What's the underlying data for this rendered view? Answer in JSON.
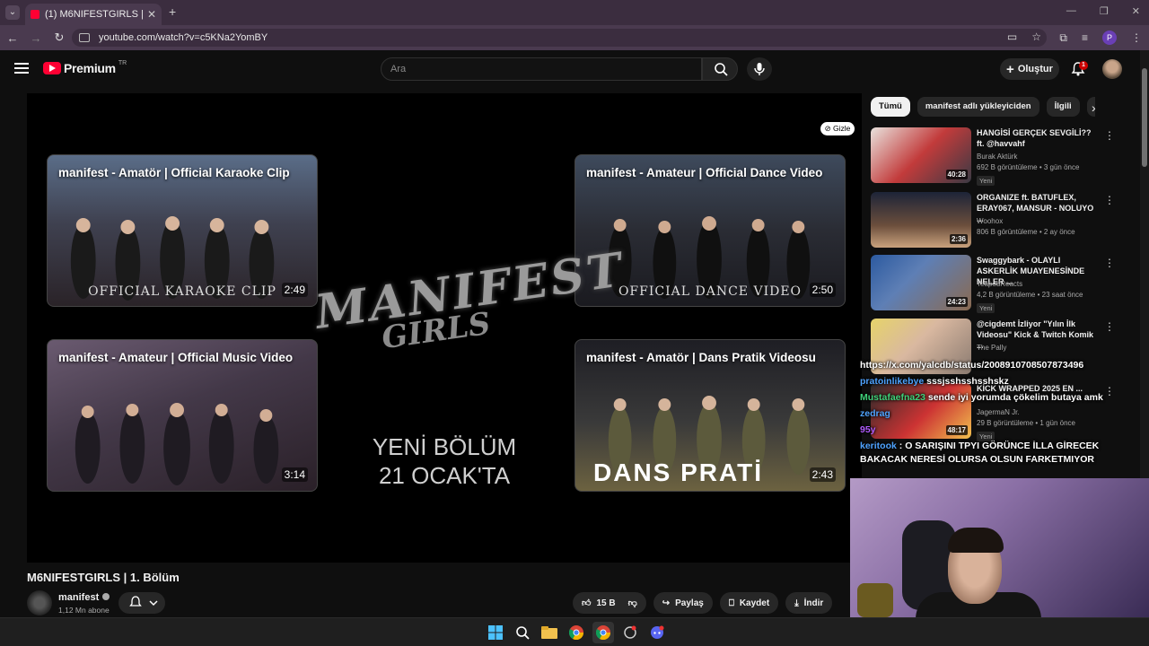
{
  "browser": {
    "tab_title": "(1) M6NIFESTGIRLS | 1. Bölüm -",
    "url": "youtube.com/watch?v=c5KNa2YomBY",
    "profile_initial": "P"
  },
  "header": {
    "logo_text": "Premium",
    "logo_region": "TR",
    "search_placeholder": "Ara",
    "create_label": "Oluştur",
    "notification_count": "1"
  },
  "player": {
    "hide_label": "Gizle",
    "center_logo_line1": "MANIFEST",
    "center_logo_line2": "GIRLS",
    "next_line1": "YENİ BÖLÜM",
    "next_line2": "21 OCAK'TA",
    "endcards": [
      {
        "title": "manifest - Amatör | Official Karaoke Clip",
        "duration": "2:49",
        "caption": "OFFICIAL KARAOKE CLIP"
      },
      {
        "title": "manifest - Amateur | Official Dance Video",
        "duration": "2:50",
        "caption": "OFFICIAL DANCE VIDEO"
      },
      {
        "title": "manifest - Amateur | Official Music Video",
        "duration": "3:14",
        "caption": ""
      },
      {
        "title": "manifest - Amatör | Dans Pratik Videosu",
        "duration": "2:43",
        "caption": "DANS PRATİ"
      }
    ]
  },
  "video": {
    "title": "M6NIFESTGIRLS | 1. Bölüm",
    "channel": "manifest",
    "subscribers": "1,12 Mn abone",
    "likes": "15 B",
    "share": "Paylaş",
    "save": "Kaydet",
    "download": "İndir"
  },
  "chips": [
    "Tümü",
    "manifest adlı yükleyiciden",
    "İlgili",
    "Sİ"
  ],
  "suggestions": [
    {
      "title": "HANGİSİ GERÇEK SEVGİLİ?? ft. @havvahf",
      "channel": "Burak Aktürk",
      "meta": "692 B görüntüleme • 3 gün önce",
      "badge": "Yeni",
      "duration": "40:28"
    },
    {
      "title": "ORGANIZE ft. BATUFLEX, ERAY067, MANSUR - NOLUYO ...",
      "channel": "Woohox",
      "meta": "806 B görüntüleme • 2 ay önce",
      "badge": "",
      "duration": "2:36"
    },
    {
      "title": "Swaggybark - OLAYLI ASKERLİK MUAYENESİNDE NELER ...",
      "channel": "TeapodReacts",
      "meta": "4,2 B görüntüleme • 23 saat önce",
      "badge": "Yeni",
      "duration": "24:23"
    },
    {
      "title": "@cigdemt İzliyor \"Yılın İlk Videosu\" Kick & Twitch Komik ...",
      "channel": "The Pally",
      "meta": "784 görüntüleme • 2 saat önce",
      "badge": "Yeni",
      "duration": ""
    },
    {
      "title": "KİCK WRAPPED 2025 EN ...",
      "channel": "JagermaN Jr.",
      "meta": "29 B görüntüleme • 1 gün önce",
      "badge": "Yeni",
      "duration": "48:17"
    }
  ],
  "chat": [
    {
      "user": "",
      "text": "https://x.com/yalcdb/status/2008910708507873496"
    },
    {
      "user": "pratoinlikebye",
      "text": "sssjsshsshsshskz"
    },
    {
      "user": "Mustafaefna23",
      "text": "sende iyi yorumda çökelim butaya amk"
    },
    {
      "user": "zedrag",
      "text": ""
    },
    {
      "user": "95y",
      "text": ""
    },
    {
      "user": "keritook",
      "text": ": O SARIŞINI TPYI GÖRÜNCE İLLA GİRECEK BAKACAK NERESİ OLURSA OLSUN FARKETMIYOR"
    }
  ],
  "colors": {
    "accent": "#ff0033",
    "bg": "#0f0f0f",
    "tab_bar": "#3b2d3f"
  }
}
